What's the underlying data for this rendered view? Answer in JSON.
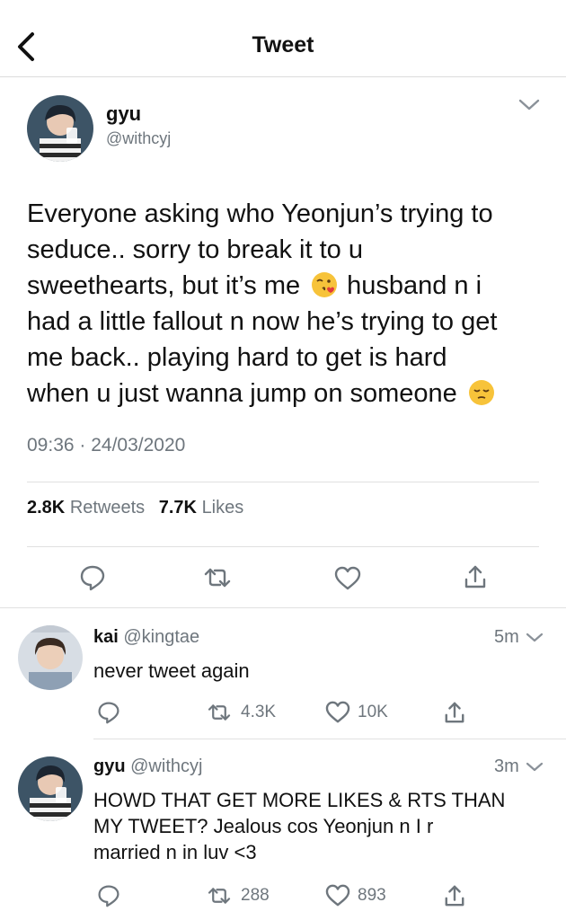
{
  "header": {
    "title": "Tweet"
  },
  "main_tweet": {
    "name": "gyu",
    "handle": "@withcyj",
    "text_lines": [
      "Everyone asking who Yeonjun’s trying to",
      "seduce.. sorry to break it to u",
      "sweethearts, but it’s me",
      "husband n i",
      "had a little fallout n now he’s trying to get",
      "me back.. playing hard to get is hard",
      "when u just wanna jump on someone"
    ],
    "emojis": [
      "face-blowing-kiss-emoji",
      "pensive-face-emoji"
    ],
    "timestamp": "09:36 · 24/03/2020",
    "retweets_count": "2.8K",
    "retweets_label": "Retweets",
    "likes_count": "7.7K",
    "likes_label": "Likes"
  },
  "replies": [
    {
      "name": "kai",
      "handle": "@kingtae",
      "time": "5m",
      "text_lines": [
        "never tweet again"
      ],
      "retweets": "4.3K",
      "likes": "10K"
    },
    {
      "name": "gyu",
      "handle": "@withcyj",
      "time": "3m",
      "text_lines": [
        "HOWD THAT GET MORE LIKES & RTS THAN",
        "MY TWEET? Jealous cos Yeonjun n I r",
        "married n in luv <3"
      ],
      "retweets": "288",
      "likes": "893"
    }
  ],
  "icons": [
    "back-chevron-icon",
    "chevron-down-icon",
    "reply-icon",
    "retweet-icon",
    "like-icon",
    "share-icon"
  ],
  "colors": {
    "text": "#111111",
    "secondary": "#6e767d",
    "divider": "#e1e1e1",
    "icon": "#6e767d"
  }
}
